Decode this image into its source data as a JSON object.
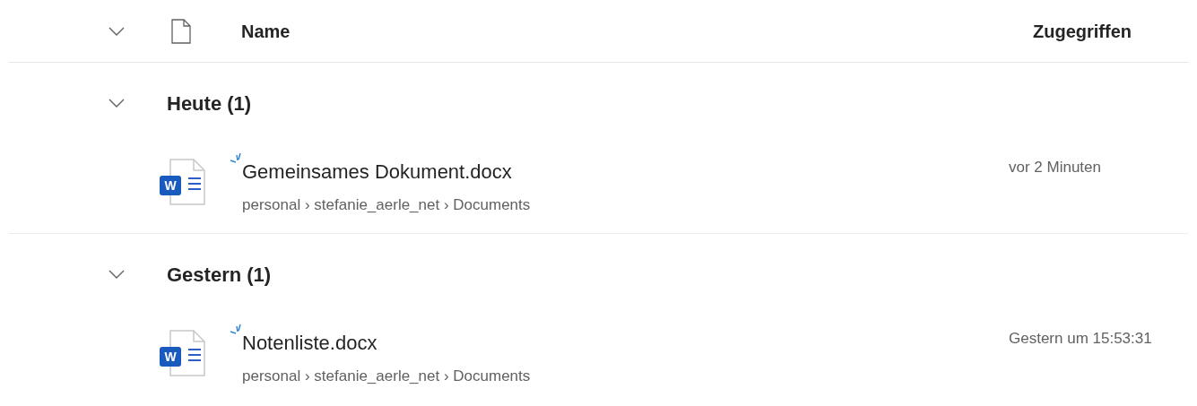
{
  "columns": {
    "name": "Name",
    "accessed": "Zugegriffen"
  },
  "groups": [
    {
      "title": "Heute (1)",
      "expanded": true,
      "files": [
        {
          "name": "Gemeinsames Dokument.docx",
          "badge": "W",
          "new": true,
          "path": "personal › stefanie_aerle_net › Documents",
          "accessed": "vor 2 Minuten"
        }
      ]
    },
    {
      "title": "Gestern (1)",
      "expanded": true,
      "files": [
        {
          "name": "Notenliste.docx",
          "badge": "W",
          "new": true,
          "path": "personal › stefanie_aerle_net › Documents",
          "accessed": "Gestern um 15:53:31"
        }
      ]
    }
  ]
}
